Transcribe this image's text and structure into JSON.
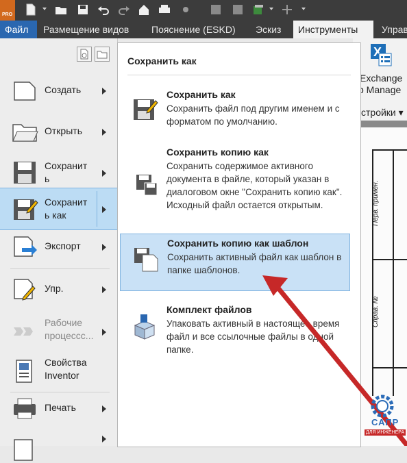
{
  "toolbar": {
    "logo_text": "PRO",
    "icons": [
      "new-icon",
      "open-icon",
      "save-icon",
      "undo-icon",
      "redo-icon",
      "home-icon",
      "print-icon",
      "dot-icon",
      "select-icon",
      "select2-icon",
      "color-icon",
      "plus-icon"
    ]
  },
  "tabs": [
    {
      "label": "Файл"
    },
    {
      "label": "Размещение видов"
    },
    {
      "label": "Пояснение (ESKD)"
    },
    {
      "label": "Эскиз"
    },
    {
      "label": "Инструменты"
    },
    {
      "label": "Управ"
    }
  ],
  "ribbon": {
    "exchange_line1": "Exchange",
    "exchange_line2": "p Manage",
    "settings": "стройки ▾"
  },
  "drawing": {
    "label1": "Перв. примен.",
    "label2": "Справ. №"
  },
  "menu": {
    "items": [
      {
        "label": "Создать",
        "arrow": true
      },
      {
        "label": "Открыть",
        "arrow": true
      },
      {
        "label": "Сохранит ь",
        "arrow": true
      },
      {
        "label": "Сохранит ь как",
        "arrow": true,
        "selected": true
      },
      {
        "label": "Экспорт",
        "arrow": true
      },
      {
        "label": "Упр.",
        "arrow": true
      },
      {
        "label": "Рабочие процессс...",
        "arrow": true,
        "disabled": true
      },
      {
        "label": "Свойства Inventor",
        "arrow": false
      },
      {
        "label": "Печать",
        "arrow": true
      },
      {
        "label": "",
        "arrow": true
      }
    ]
  },
  "submenu": {
    "title": "Сохранить как",
    "options": [
      {
        "title": "Сохранить как",
        "desc": "Сохранить файл под другим именем и с форматом по умолчанию."
      },
      {
        "title": "Сохранить копию как",
        "desc": "Сохранить содержимое активного документа в файле, который указан в диалоговом окне \"Сохранить копию как\". Исходный файл остается открытым."
      },
      {
        "title": "Сохранить копию как шаблон",
        "desc": "Сохранить активный файл как шаблон в папке шаблонов.",
        "highlighted": true
      },
      {
        "title": "Комплект файлов",
        "desc": "Упаковать активный в настоящее время файл и все ссылочные файлы в одной папке."
      }
    ]
  },
  "watermark": {
    "line1": "САПР",
    "line2": "ДЛЯ ИНЖЕНЕРА"
  },
  "colors": {
    "accent": "#2a67b0",
    "arrow": "#c62828",
    "highlight": "#c9e1f6"
  }
}
